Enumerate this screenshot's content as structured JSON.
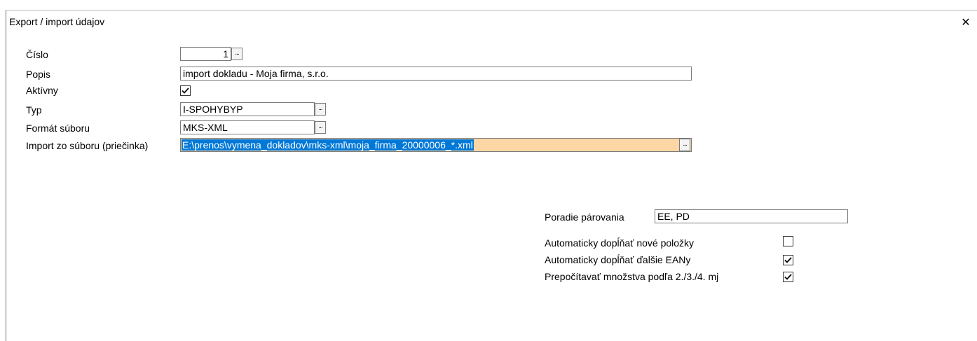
{
  "window": {
    "title": "Export / import údajov",
    "close_glyph": "✕"
  },
  "form": {
    "cislo": {
      "label": "Číslo",
      "value": "1"
    },
    "popis": {
      "label": "Popis",
      "value": "import dokladu - Moja firma, s.r.o."
    },
    "aktivny": {
      "label": "Aktívny",
      "checked": true
    },
    "typ": {
      "label": "Typ",
      "value": "I-SPOHYBYP"
    },
    "format": {
      "label": "Formát súboru",
      "value": "MKS-XML"
    },
    "import_path": {
      "label": "Import zo súboru (priečinka)",
      "value": "E:\\prenos\\vymena_dokladov\\mks-xml\\moja_firma_20000006_*.xml"
    },
    "ellipsis": "..."
  },
  "options": {
    "poradie": {
      "label": "Poradie párovania",
      "value": "EE, PD"
    },
    "auto_nove": {
      "label": "Automaticky dopĺňať nové položky",
      "checked": false
    },
    "auto_ean": {
      "label": "Automaticky dopĺňať ďalšie EANy",
      "checked": true
    },
    "prepocitavat": {
      "label": "Prepočítavať množstva podľa 2./3./4. mj",
      "checked": true
    }
  },
  "colors": {
    "selection": "#0078d7",
    "focused_field": "#fdd6a6"
  }
}
